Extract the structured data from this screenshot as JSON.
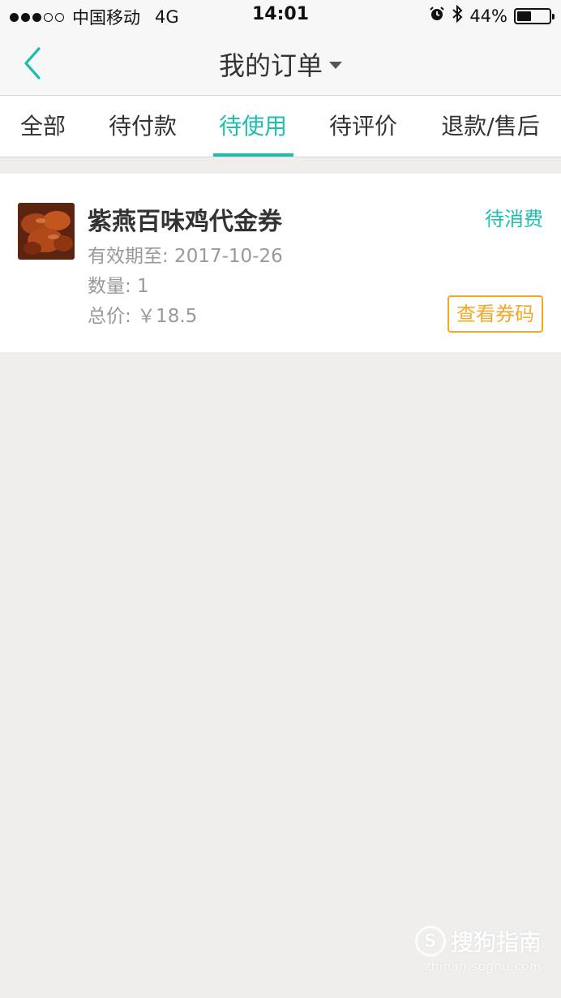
{
  "status_bar": {
    "carrier": "中国移动",
    "network": "4G",
    "time": "14:01",
    "battery": "44%",
    "battery_level": 0.44
  },
  "nav": {
    "title": "我的订单"
  },
  "tabs": [
    {
      "label": "全部"
    },
    {
      "label": "待付款"
    },
    {
      "label": "待使用"
    },
    {
      "label": "待评价"
    },
    {
      "label": "退款/售后"
    }
  ],
  "active_tab": "待使用",
  "order": {
    "title": "紫燕百味鸡代金券",
    "status": "待消费",
    "validity": "有效期至: 2017-10-26",
    "quantity": "数量: 1",
    "total": "总价: ￥18.5",
    "action_label": "查看券码"
  },
  "watermark": {
    "brand": "搜狗指南",
    "url": "zhinan.sogou.com"
  },
  "colors": {
    "accent": "#1ebdb0",
    "action": "#f5a623",
    "background": "#efeeec"
  }
}
